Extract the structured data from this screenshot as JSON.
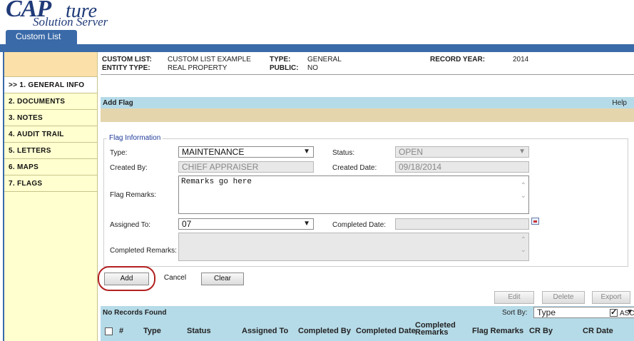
{
  "app": {
    "logo_main": "CAP",
    "logo_script": "ture",
    "logo_sub": "Solution Server"
  },
  "tab": {
    "label": "Custom List"
  },
  "sidebar": {
    "items": [
      {
        "label": ">> 1. GENERAL INFO"
      },
      {
        "label": "2. DOCUMENTS"
      },
      {
        "label": "3. NOTES"
      },
      {
        "label": "4. AUDIT TRAIL"
      },
      {
        "label": "5. LETTERS"
      },
      {
        "label": "6. MAPS"
      },
      {
        "label": "7. FLAGS"
      }
    ]
  },
  "header": {
    "custom_list_label": "CUSTOM LIST:",
    "custom_list_value": "CUSTOM LIST EXAMPLE",
    "type_label": "TYPE:",
    "type_value": "GENERAL",
    "record_year_label": "RECORD YEAR:",
    "record_year_value": "2014",
    "entity_type_label": "ENTITY TYPE:",
    "entity_type_value": "REAL PROPERTY",
    "public_label": "PUBLIC:",
    "public_value": "NO"
  },
  "section": {
    "title": "Add Flag",
    "help": "Help"
  },
  "form": {
    "legend": "Flag Information",
    "type_label": "Type:",
    "type_value": "MAINTENANCE",
    "status_label": "Status:",
    "status_value": "OPEN",
    "created_by_label": "Created By:",
    "created_by_value": "CHIEF APPRAISER",
    "created_date_label": "Created Date:",
    "created_date_value": "09/18/2014",
    "remarks_label": "Flag Remarks:",
    "remarks_value": "Remarks go here",
    "assigned_to_label": "Assigned To:",
    "assigned_to_value": "07",
    "completed_date_label": "Completed Date:",
    "completed_date_value": "",
    "completed_remarks_label": "Completed Remarks:",
    "completed_remarks_value": ""
  },
  "buttons": {
    "add": "Add",
    "cancel": "Cancel",
    "clear": "Clear",
    "edit": "Edit",
    "delete": "Delete",
    "export": "Export"
  },
  "records": {
    "status": "No Records Found",
    "sort_by_label": "Sort By:",
    "sort_by_value": "Type",
    "asc_label": "ASC",
    "asc_checked": true
  },
  "table": {
    "columns": [
      "#",
      "Type",
      "Status",
      "Assigned To",
      "Completed By",
      "Completed Date",
      "Completed Remarks",
      "Flag Remarks",
      "CR By",
      "CR Date"
    ]
  },
  "colors": {
    "brand_blue": "#3a6aa8",
    "header_band": "#b6dbe8",
    "sidebar_bg": "#ffffd0",
    "highlight": "#b32020"
  }
}
